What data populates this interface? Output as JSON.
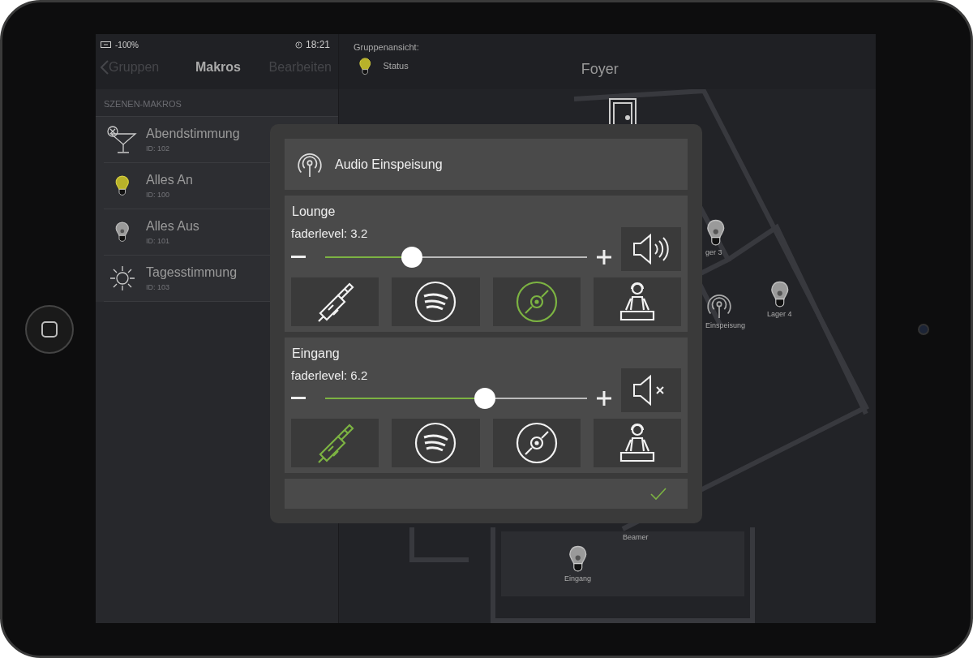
{
  "status_bar": {
    "battery": "-100%",
    "time": "18:21"
  },
  "nav": {
    "back": "Gruppen",
    "title": "Makros",
    "action": "Bearbeiten"
  },
  "section_header": "SZENEN-MAKROS",
  "macros": [
    {
      "name": "Abendstimmung",
      "id": "ID: 102",
      "kind": "cocktail"
    },
    {
      "name": "Alles An",
      "id": "ID: 100",
      "kind": "bulb_on"
    },
    {
      "name": "Alles Aus",
      "id": "ID: 101",
      "kind": "bulb_off"
    },
    {
      "name": "Tagesstimmung",
      "id": "ID: 103",
      "kind": "sun"
    }
  ],
  "group_view": {
    "label": "Gruppenansicht:",
    "status": "Status",
    "status_on": true,
    "title": "Foyer"
  },
  "map_labels": [
    {
      "text": "ger 3",
      "kind": "bulb"
    },
    {
      "text": "Einspeisung",
      "kind": "antenna"
    },
    {
      "text": "Lager 4",
      "kind": "bulb"
    },
    {
      "text": "Beamer",
      "kind": "text"
    },
    {
      "text": "Eingang",
      "kind": "bulb"
    }
  ],
  "dialog": {
    "title": "Audio Einspeisung",
    "zones": [
      {
        "name": "Lounge",
        "reading": "faderlevel: 3.2",
        "level": 0.33,
        "muted": false,
        "sources": [
          {
            "kind": "cinch",
            "selected": false
          },
          {
            "kind": "spotify",
            "selected": false
          },
          {
            "kind": "cd",
            "selected": true
          },
          {
            "kind": "dj",
            "selected": false
          }
        ]
      },
      {
        "name": "Eingang",
        "reading": "faderlevel: 6.2",
        "level": 0.61,
        "muted": true,
        "sources": [
          {
            "kind": "cinch",
            "selected": true
          },
          {
            "kind": "spotify",
            "selected": false
          },
          {
            "kind": "cd",
            "selected": false
          },
          {
            "kind": "dj",
            "selected": false
          }
        ]
      }
    ]
  }
}
